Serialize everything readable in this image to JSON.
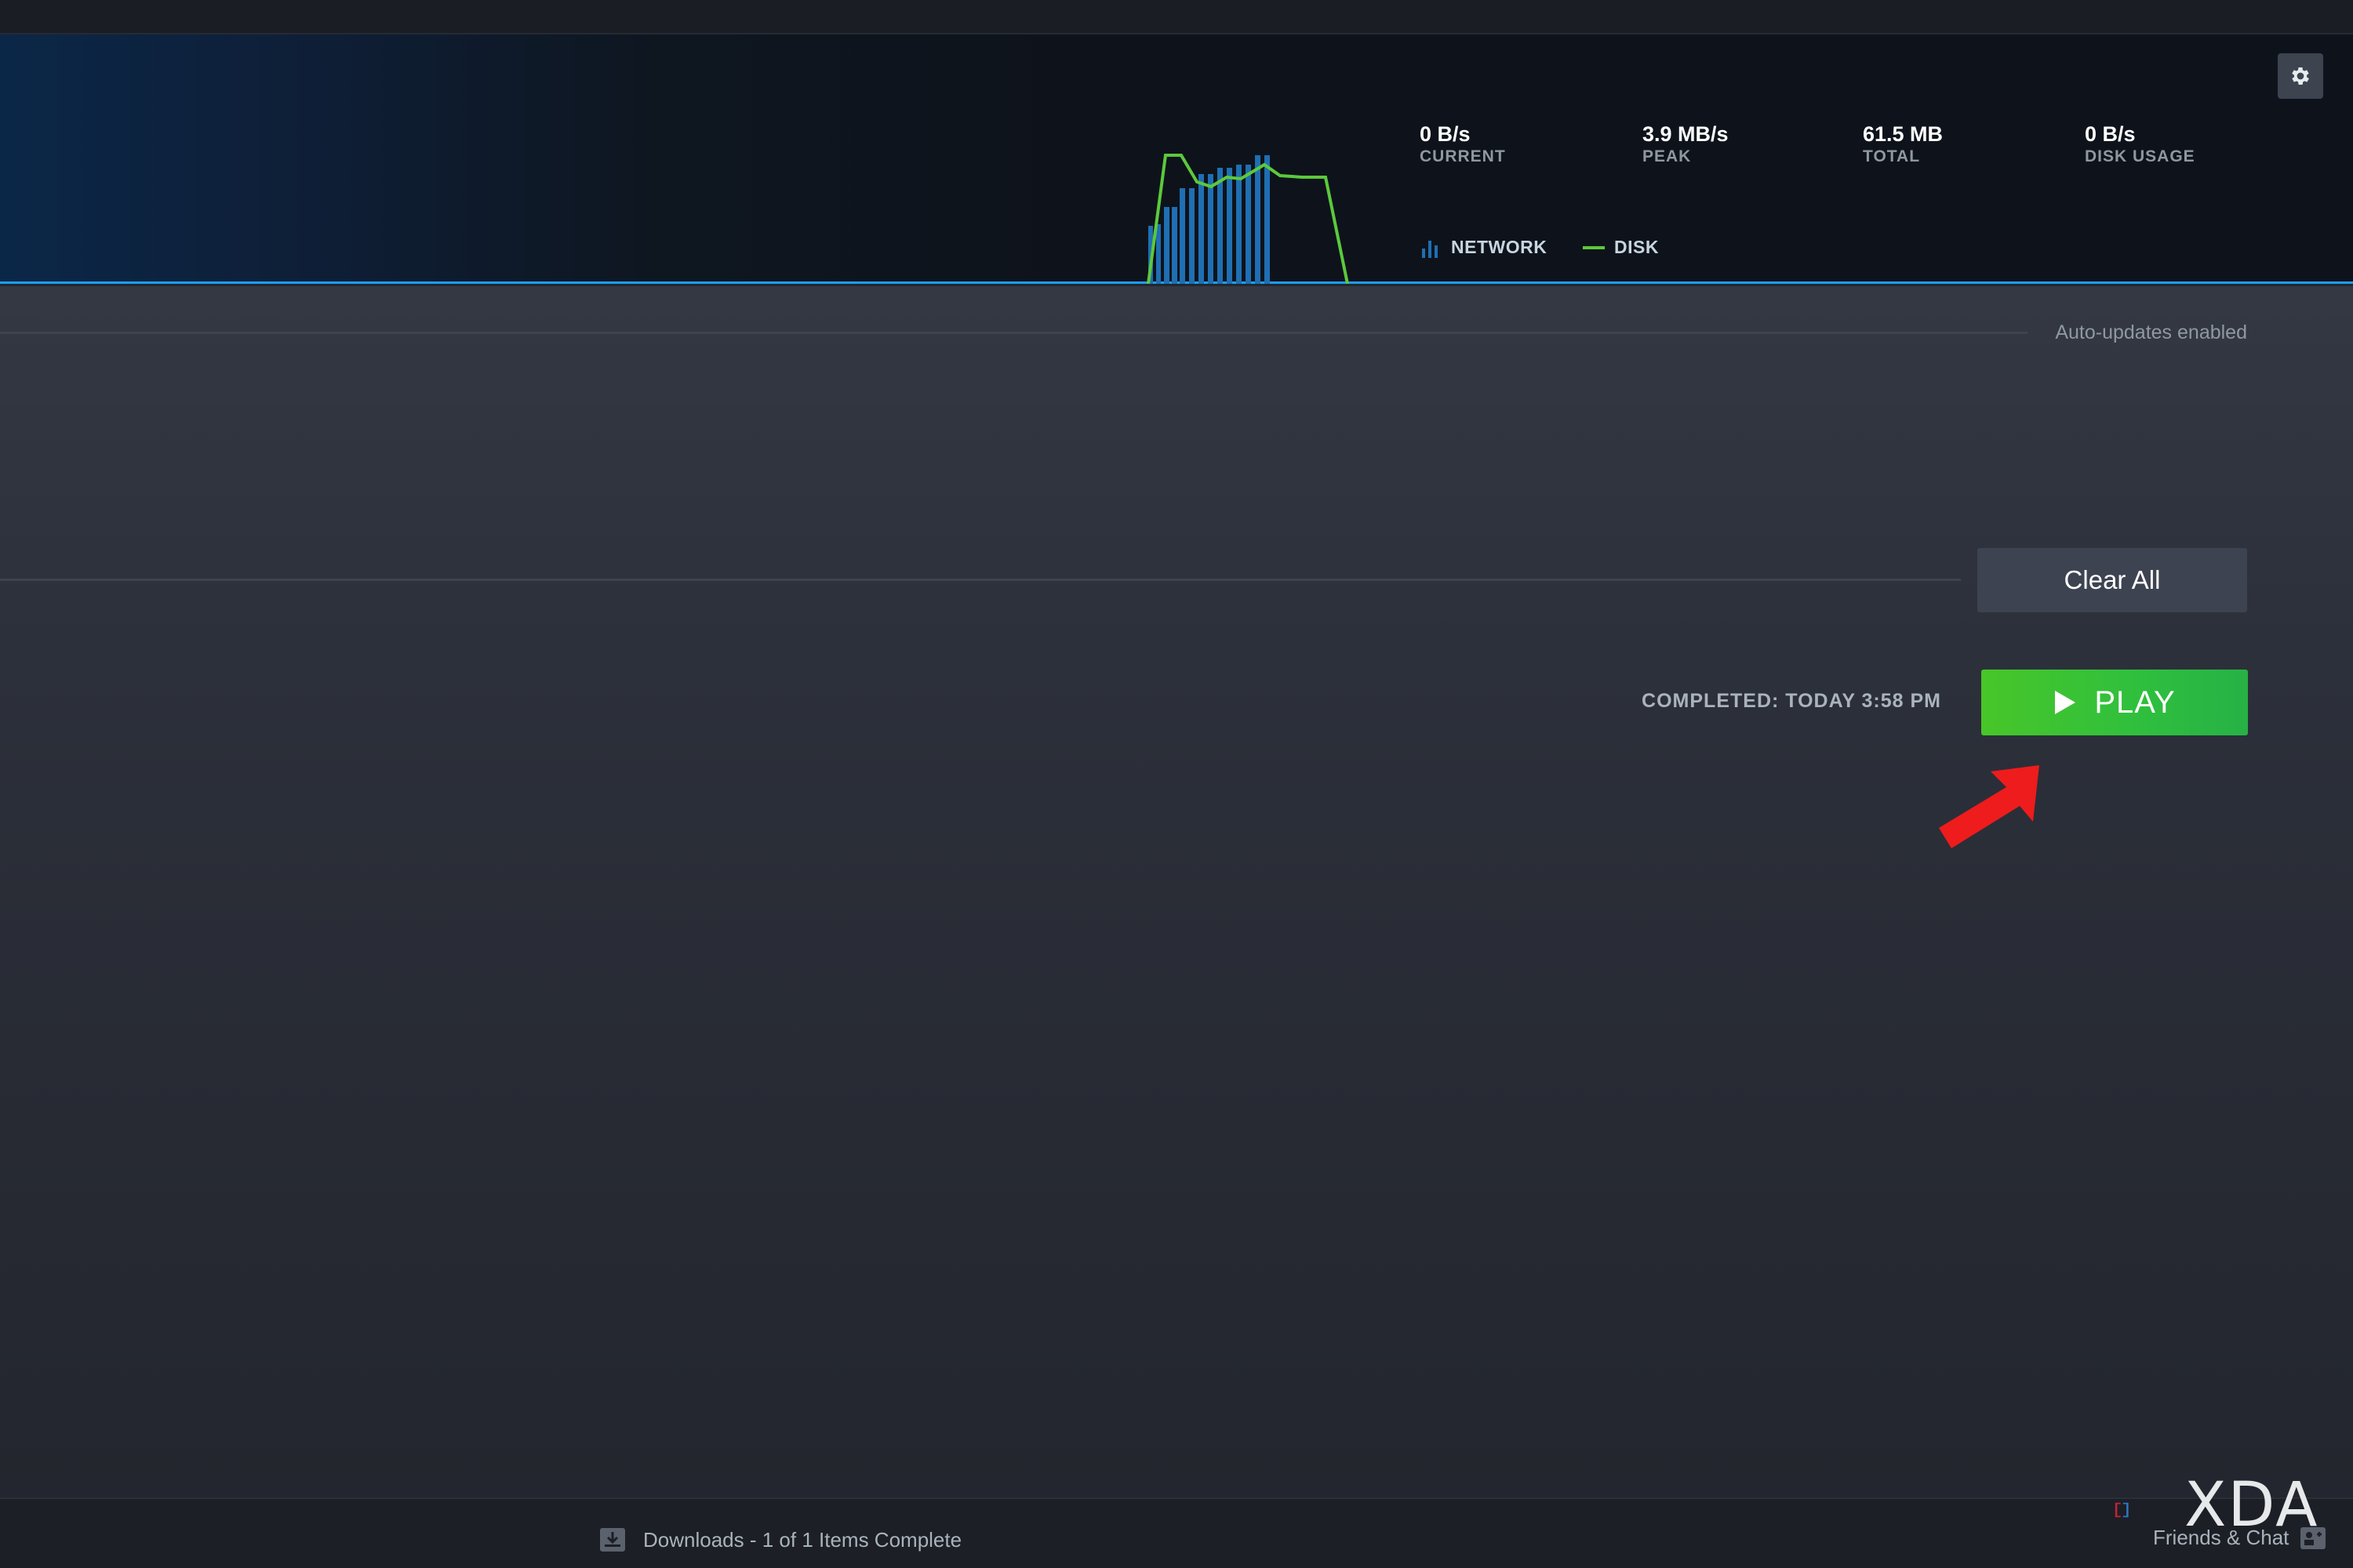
{
  "header": {
    "stats": [
      {
        "value": "0 B/s",
        "label": "CURRENT"
      },
      {
        "value": "3.9 MB/s",
        "label": "PEAK"
      },
      {
        "value": "61.5 MB",
        "label": "TOTAL"
      },
      {
        "value": "0 B/s",
        "label": "DISK USAGE"
      }
    ],
    "legend": {
      "network": "NETWORK",
      "disk": "DISK"
    },
    "icons": {
      "settings": "gear-icon",
      "network": "bar-chart-icon",
      "disk": "line-icon"
    },
    "colors": {
      "network": "#1f6fb2",
      "disk": "#5cc93c",
      "accent": "#1a9fff"
    }
  },
  "main": {
    "auto_updates": "Auto-updates enabled",
    "clear_all_label": "Clear All",
    "completed_text": "COMPLETED: TODAY 3:58 PM",
    "play_label": "PLAY",
    "play_color": "#3dc13b"
  },
  "footer": {
    "downloads_status": "Downloads - 1 of 1 Items Complete",
    "friends_chat": "Friends & Chat",
    "watermark": "XDA"
  }
}
